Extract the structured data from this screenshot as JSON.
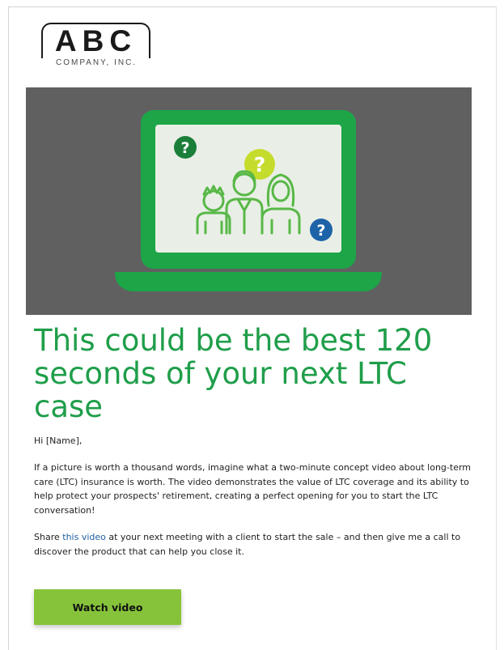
{
  "brand": {
    "logo_main": "ABC",
    "logo_sub": "COMPANY, INC."
  },
  "hero": {
    "icons": [
      "laptop-icon",
      "question-mark-icon",
      "child-avatar-icon",
      "man-avatar-icon",
      "woman-avatar-icon"
    ],
    "question_mark": "?",
    "colors": {
      "background": "#606061",
      "laptop_frame": "#1da548",
      "laptop_screen": "#e9efe6",
      "figure_stroke": "#58b847",
      "bubble_dark_green": "#1b7f3a",
      "bubble_yellow": "#c6dc2c",
      "bubble_blue": "#1d63a8"
    }
  },
  "email": {
    "headline": "This could be the best 120 seconds of your next LTC case",
    "greeting": "Hi [Name],",
    "paragraph1": "If a picture is worth a thousand words, imagine what a two-minute concept video about long-term care (LTC) insurance is worth. The video demonstrates the value of LTC coverage and its ability to help protect your prospects' retirement, creating a perfect opening for you to start the LTC conversation!",
    "paragraph2_before": "Share ",
    "paragraph2_link": "this video",
    "paragraph2_after": " at your next meeting with a client to start the sale – and then give me a call to discover the product that can help you close it.",
    "cta_label": "Watch video"
  },
  "colors": {
    "headline": "#1f9e4a",
    "link": "#1f5fa0",
    "cta_background": "#86c33a"
  }
}
